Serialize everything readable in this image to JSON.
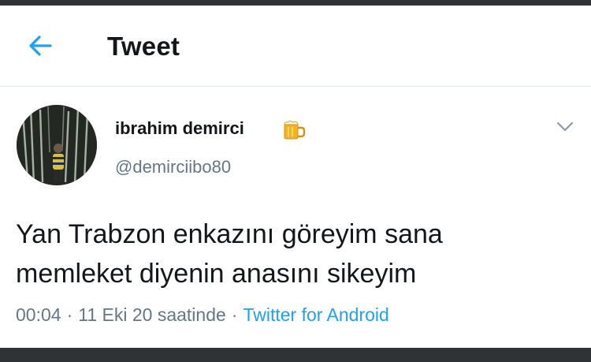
{
  "header": {
    "title": "Tweet",
    "back_icon": "arrow-left-icon"
  },
  "tweet": {
    "author": {
      "name": "ibrahim demirci",
      "name_emoji_icon": "beer-mug-icon",
      "handle": "@demirciibo80"
    },
    "text_lines": [
      "Yan Trabzon enkazını göreyim sana",
      "memleket diyenin anasını sikeyim"
    ],
    "meta": {
      "time": "00:04",
      "separator": "·",
      "date": "11 Eki 20 saatinde",
      "source": "Twitter for Android"
    },
    "menu_icon": "chevron-down-icon"
  },
  "colors": {
    "accent": "#1da1f2",
    "secondary_text": "#657786",
    "primary_text": "#14171a",
    "divider": "#e1e8ed",
    "frame": "#2f3336"
  }
}
